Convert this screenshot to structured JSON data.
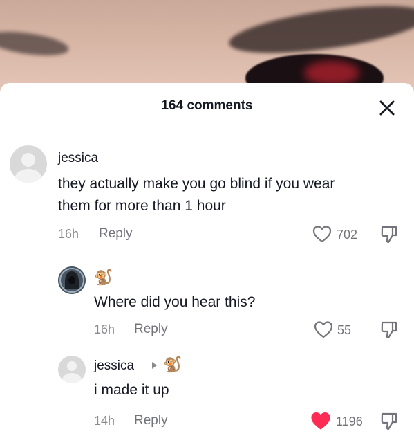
{
  "header": {
    "comment_count": "164 comments"
  },
  "comments": [
    {
      "author": "jessica",
      "text_line1": "they actually make you go blind if you wear",
      "text_line2": "them for more than 1 hour",
      "time": "16h",
      "reply_label": "Reply",
      "likes": "702",
      "liked": false
    },
    {
      "author_emoji": "🐒",
      "text": "Where did you hear this?",
      "time": "16h",
      "reply_label": "Reply",
      "likes": "55",
      "liked": false
    },
    {
      "author": "jessica",
      "reply_to_emoji": "🐒",
      "text": "i made it up",
      "time": "14h",
      "reply_label": "Reply",
      "likes": "1196",
      "liked": true
    }
  ],
  "colors": {
    "liked_heart": "#fe2c55",
    "text": "#161823",
    "muted": "#73747b"
  },
  "icons": [
    "close-icon",
    "heart-icon",
    "dislike-icon",
    "default-avatar-icon",
    "caret-right-icon"
  ]
}
